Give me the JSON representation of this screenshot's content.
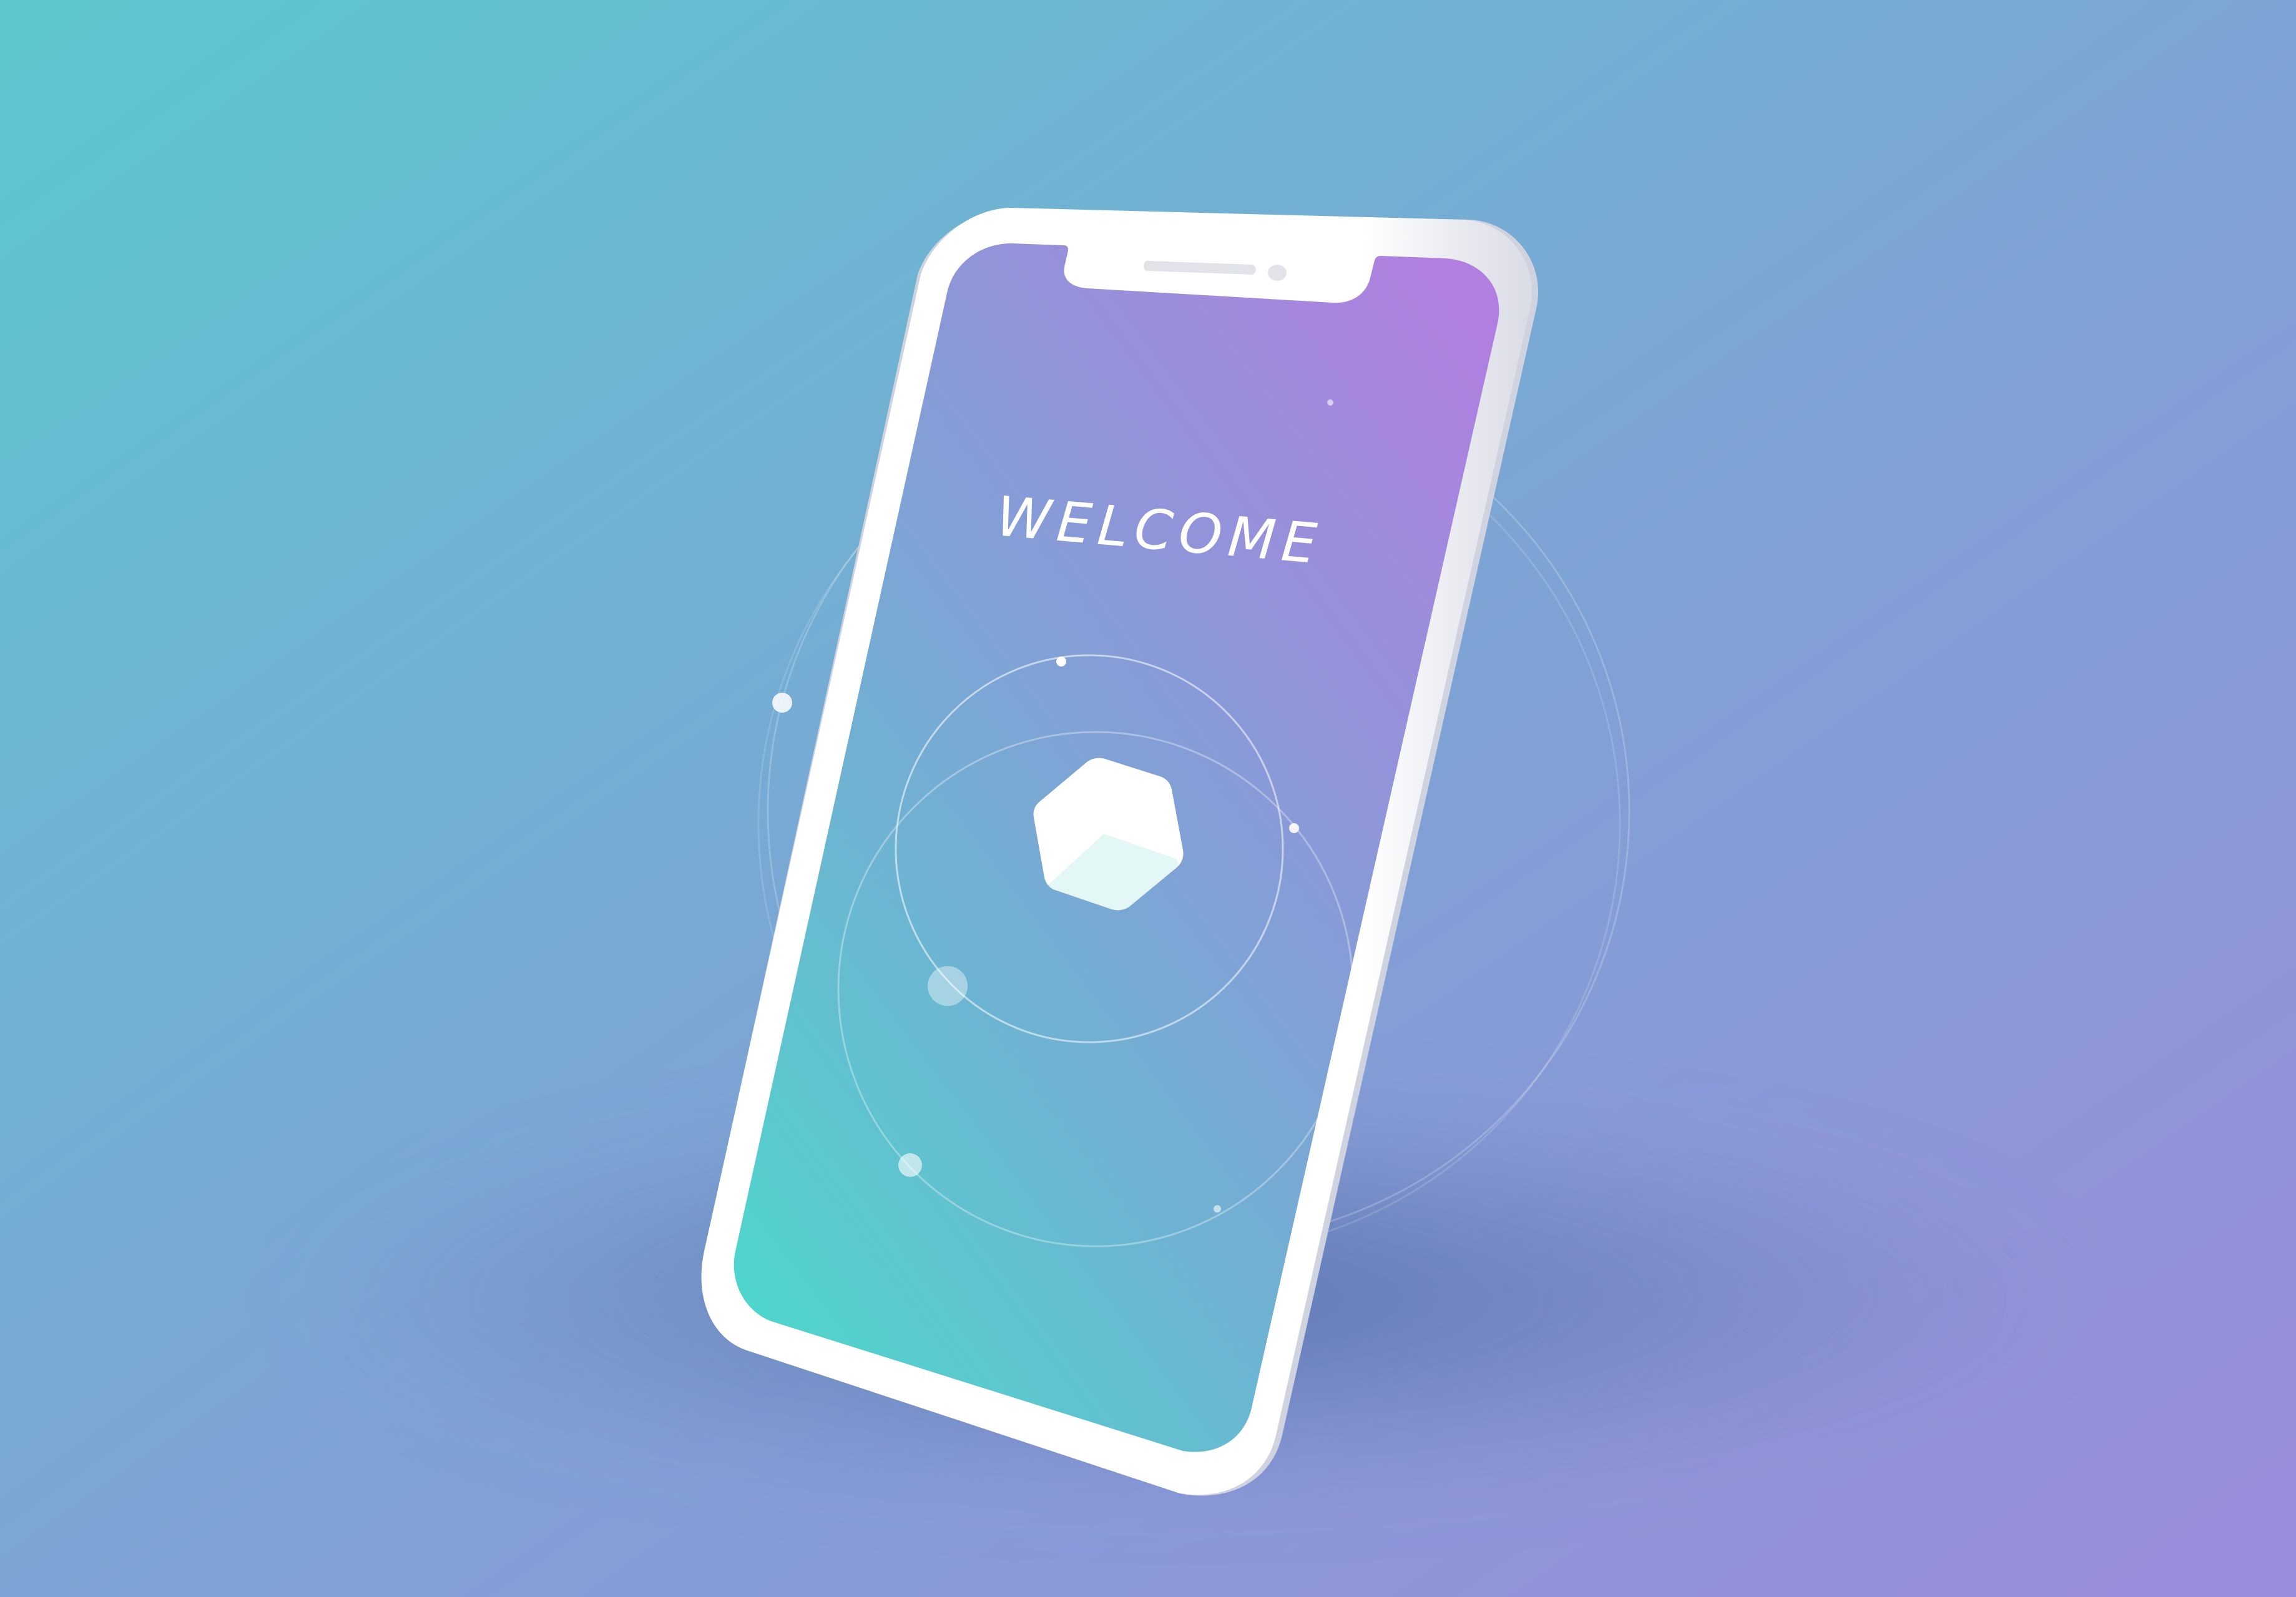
{
  "screen": {
    "welcome_text": "WELCOME"
  },
  "colors": {
    "background_start": "#5cc7cf",
    "background_end": "#9a8bdc",
    "screen_gradient_top": "#b07fe0",
    "screen_gradient_bottom": "#4dd8cc",
    "phone_frame": "#ffffff",
    "logo_face": "#ffffff",
    "logo_shadow_face": "#e3f7f6"
  },
  "icons": {
    "app_logo": "cube-icon",
    "speaker": "speaker-grille-icon",
    "camera": "front-camera-icon"
  }
}
